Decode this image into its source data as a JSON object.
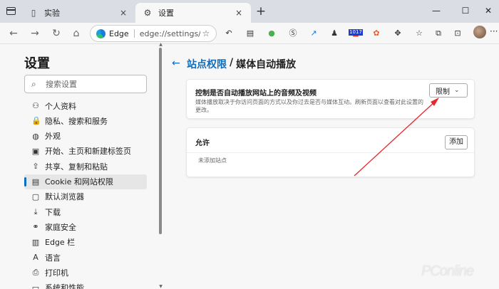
{
  "tabs": [
    {
      "title": "实验",
      "close": "×"
    },
    {
      "title": "设置",
      "close": "×"
    }
  ],
  "newtab": "+",
  "window_controls": [
    "—",
    "☐",
    "✕"
  ],
  "nav": {
    "back": "←",
    "forward": "→",
    "refresh": "↻",
    "home": "⌂"
  },
  "address": {
    "brand": "Edge",
    "url": "edge://settings/co..."
  },
  "extension_badge": "1017",
  "sidebar": {
    "title": "设置",
    "search_placeholder": "搜索设置",
    "items": [
      {
        "label": "个人资料",
        "icon": "person-icon"
      },
      {
        "label": "隐私、搜索和服务",
        "icon": "lock-icon"
      },
      {
        "label": "外观",
        "icon": "appearance-icon"
      },
      {
        "label": "开始、主页和新建标签页",
        "icon": "home-page-icon"
      },
      {
        "label": "共享、复制和粘贴",
        "icon": "share-icon"
      },
      {
        "label": "Cookie 和网站权限",
        "icon": "site-permissions-icon"
      },
      {
        "label": "默认浏览器",
        "icon": "browser-icon"
      },
      {
        "label": "下载",
        "icon": "download-icon"
      },
      {
        "label": "家庭安全",
        "icon": "family-icon"
      },
      {
        "label": "Edge 栏",
        "icon": "edge-bar-icon"
      },
      {
        "label": "语言",
        "icon": "language-icon"
      },
      {
        "label": "打印机",
        "icon": "printer-icon"
      },
      {
        "label": "系统和性能",
        "icon": "system-icon"
      }
    ],
    "active_index": 5
  },
  "breadcrumb": {
    "parent": "站点权限",
    "separator": "/",
    "current": "媒体自动播放"
  },
  "autoplay_card": {
    "heading": "控制是否自动播放网站上的音频及视频",
    "description": "媒体播放取决于你访问页面的方式以及你过去是否与媒体互动。刷新页面以查看对此设置的更改。",
    "select_value": "限制"
  },
  "allow_card": {
    "heading": "允许",
    "add_button": "添加",
    "empty_text": "未添加站点"
  },
  "watermark": "PConline",
  "colors": {
    "accent": "#0f6cbd",
    "arrow": "#e8262a"
  }
}
